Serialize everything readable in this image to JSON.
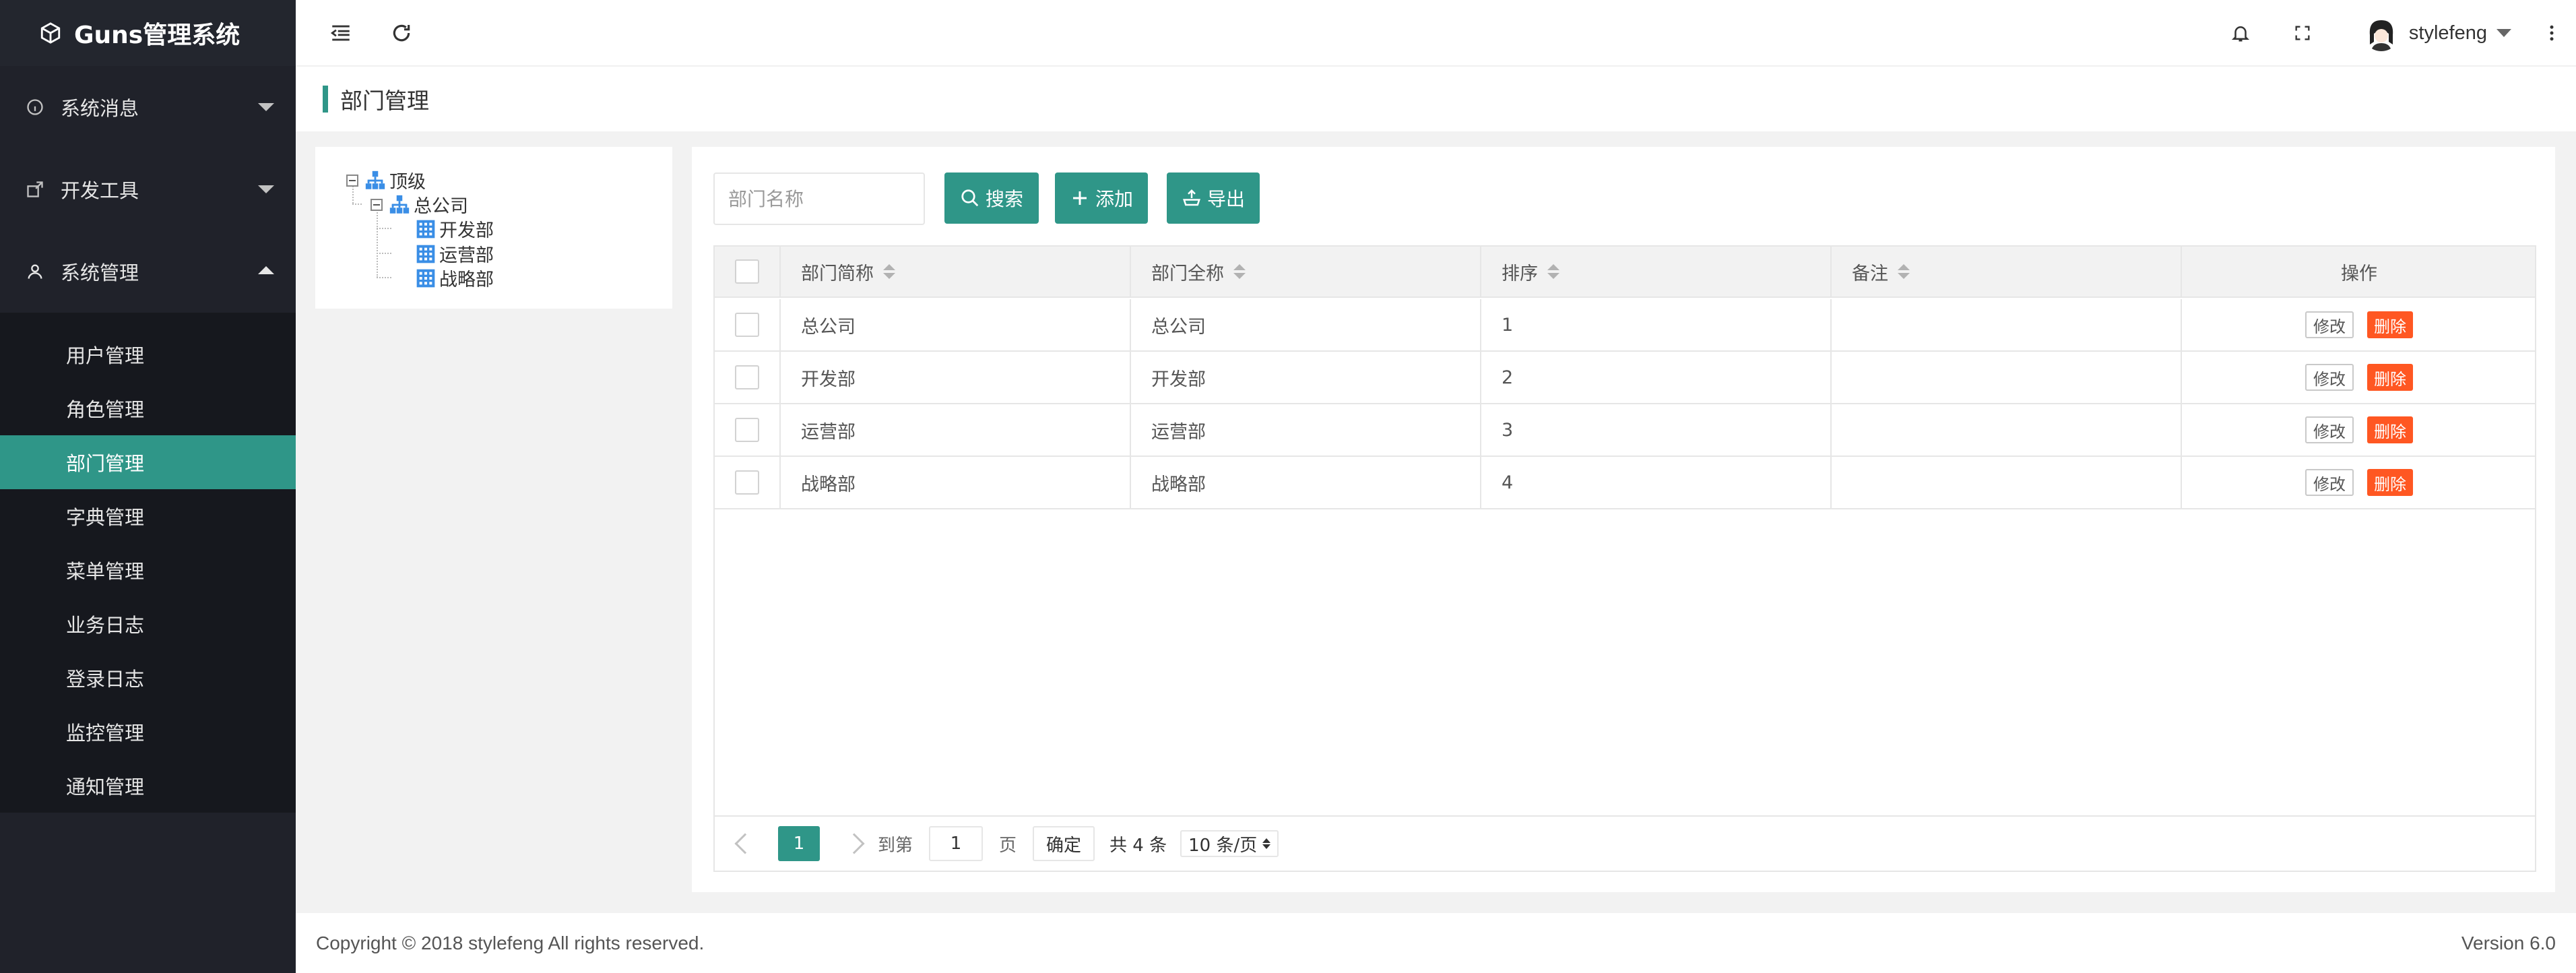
{
  "app": {
    "title": "Guns管理系统"
  },
  "sidebar": {
    "groups": [
      {
        "label": "系统消息",
        "icon": "info-icon",
        "expanded": false
      },
      {
        "label": "开发工具",
        "icon": "devtools-icon",
        "expanded": false
      },
      {
        "label": "系统管理",
        "icon": "user-icon",
        "expanded": true
      }
    ],
    "sub_items": [
      {
        "label": "用户管理",
        "active": false
      },
      {
        "label": "角色管理",
        "active": false
      },
      {
        "label": "部门管理",
        "active": true
      },
      {
        "label": "字典管理",
        "active": false
      },
      {
        "label": "菜单管理",
        "active": false
      },
      {
        "label": "业务日志",
        "active": false
      },
      {
        "label": "登录日志",
        "active": false
      },
      {
        "label": "监控管理",
        "active": false
      },
      {
        "label": "通知管理",
        "active": false
      }
    ]
  },
  "header": {
    "user_name": "stylefeng",
    "icons": [
      "menu-fold-icon",
      "refresh-icon",
      "bell-icon",
      "fullscreen-icon",
      "more-vertical-icon"
    ]
  },
  "page": {
    "title": "部门管理"
  },
  "tree": {
    "root": "顶级",
    "company": "总公司",
    "children": [
      "开发部",
      "运营部",
      "战略部"
    ]
  },
  "toolbar": {
    "search_placeholder": "部门名称",
    "search_label": "搜索",
    "add_label": "添加",
    "export_label": "导出"
  },
  "table": {
    "columns": [
      "部门简称",
      "部门全称",
      "排序",
      "备注",
      "操作"
    ],
    "rows": [
      {
        "short": "总公司",
        "full": "总公司",
        "sort": "1",
        "note": ""
      },
      {
        "short": "开发部",
        "full": "开发部",
        "sort": "2",
        "note": ""
      },
      {
        "short": "运营部",
        "full": "运营部",
        "sort": "3",
        "note": ""
      },
      {
        "short": "战略部",
        "full": "战略部",
        "sort": "4",
        "note": ""
      }
    ],
    "edit_label": "修改",
    "delete_label": "删除"
  },
  "pager": {
    "current": "1",
    "goto_label": "到第",
    "page_value": "1",
    "page_unit": "页",
    "confirm_label": "确定",
    "total_label": "共 4 条",
    "page_size_label": "10 条/页"
  },
  "footer": {
    "copyright": "Copyright © 2018 stylefeng All rights reserved.",
    "version": "Version 6.0"
  },
  "colors": {
    "primary": "#2f9688",
    "danger": "#ff5722",
    "sidebar": "#20222a"
  }
}
